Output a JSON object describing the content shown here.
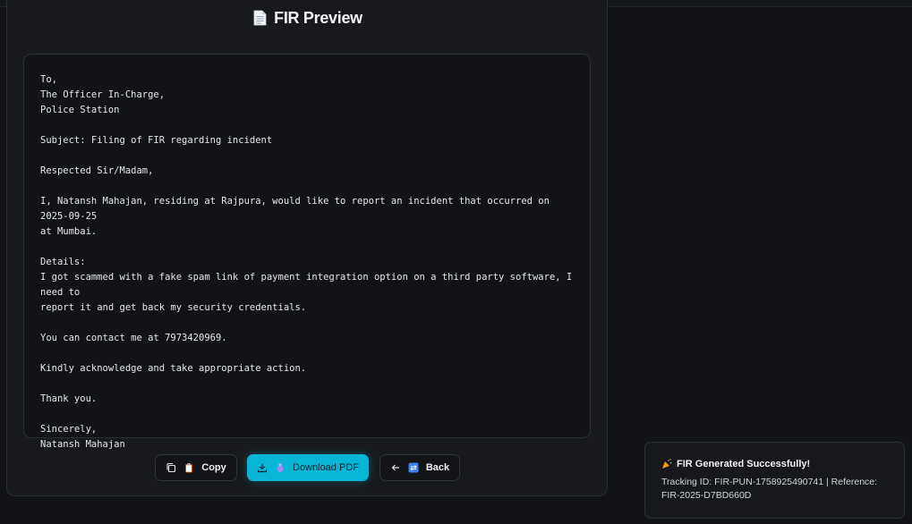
{
  "header": {
    "title": "FIR Preview",
    "icon": "document-icon"
  },
  "letter": {
    "text": "To,\nThe Officer In-Charge,\nPolice Station\n\nSubject: Filing of FIR regarding incident\n\nRespected Sir/Madam,\n\nI, Natansh Mahajan, residing at Rajpura, would like to report an incident that occurred on 2025-09-25\nat Mumbai.\n\nDetails:\nI got scammed with a fake spam link of payment integration option on a third party software, I need to\nreport it and get back my security credentials.\n\nYou can contact me at 7973420969.\n\nKindly acknowledge and take appropriate action.\n\nThank you.\n\nSincerely,\nNatansh Mahajan"
  },
  "actions": {
    "copy_label": "Copy",
    "download_label": "Download PDF",
    "back_label": "Back"
  },
  "toast": {
    "title": "FIR Generated Successfully!",
    "body": "Tracking ID: FIR-PUN-1758925490741 | Reference: FIR-2025-D7BD660D",
    "icon": "party-popper-icon"
  },
  "colors": {
    "background": "#111316",
    "panel": "#17191d",
    "accent": "#06b6d4"
  }
}
